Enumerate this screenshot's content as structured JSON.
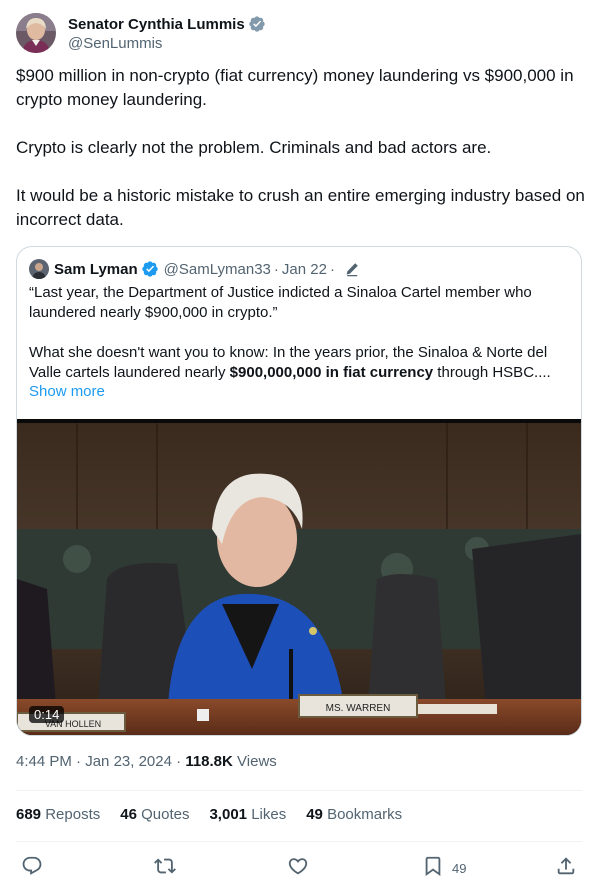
{
  "author": {
    "display_name": "Senator Cynthia Lummis",
    "handle": "@SenLummis",
    "verified_icon": "verified-gray-badge"
  },
  "tweet": {
    "paragraph_1": "$900 million in non-crypto (fiat currency) money laundering vs $900,000 in crypto money laundering.",
    "paragraph_2": "Crypto is clearly not the problem. Criminals and bad actors are.",
    "paragraph_3": "It would be a historic mistake to crush an entire emerging industry based on incorrect data."
  },
  "quote": {
    "name": "Sam Lyman",
    "handle": "@SamLyman33",
    "separator": "·",
    "date": "Jan 22",
    "separator_2": "·",
    "text_1": "“Last year, the Department of Justice indicted a Sinaloa Cartel member who laundered nearly $900,000 in crypto.”",
    "text_2_before": "What she doesn't want you to know: In the years prior, the Sinaloa & Norte del Valle cartels laundered nearly ",
    "text_2_bold": "$900,000,000 in fiat currency",
    "text_2_after": " through HSBC....",
    "show_more": "Show more",
    "video": {
      "duration": "0:14",
      "nameplate": "MS. WARREN",
      "nameplate_left": "VAN HOLLEN"
    }
  },
  "meta": {
    "time": "4:44 PM",
    "dot": "·",
    "date": "Jan 23, 2024",
    "dot_2": "·",
    "views_count": "118.8K",
    "views_label": "Views"
  },
  "stats": {
    "reposts_count": "689",
    "reposts_label": "Reposts",
    "quotes_count": "46",
    "quotes_label": "Quotes",
    "likes_count": "3,001",
    "likes_label": "Likes",
    "bookmarks_count": "49",
    "bookmarks_label": "Bookmarks"
  },
  "actions": {
    "reply_icon": "reply-icon",
    "repost_icon": "repost-icon",
    "like_icon": "heart-icon",
    "bookmark_icon": "bookmark-icon",
    "bookmark_count": "49",
    "share_icon": "share-icon"
  },
  "colors": {
    "link": "#1d9bf0",
    "secondary_text": "#536471",
    "primary_text": "#0f1419",
    "verified_gray": "#829aab",
    "verified_blue": "#1d9bf0",
    "border": "#cfd9de"
  }
}
